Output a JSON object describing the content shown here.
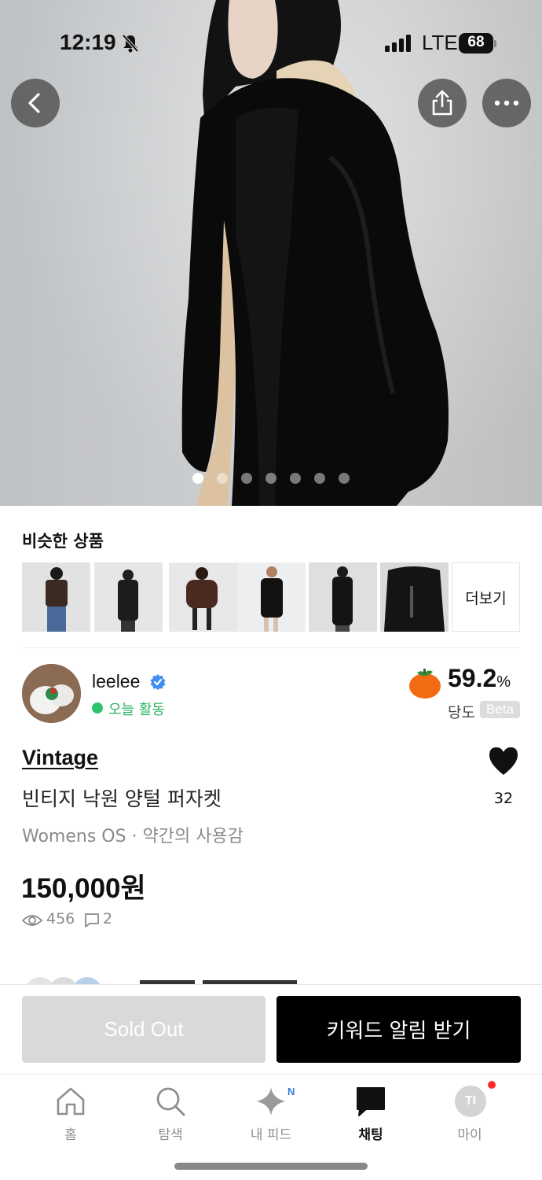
{
  "status_bar": {
    "time": "12:19",
    "network": "LTE",
    "battery": "68"
  },
  "hero": {
    "image_count": 7,
    "active_index": 0
  },
  "similar": {
    "title": "비슷한 상품",
    "more_label": "더보기",
    "thumb_count": 6
  },
  "seller": {
    "name": "leelee",
    "activity": "오늘 활동",
    "score_value": "59.2",
    "score_unit": "%",
    "score_label": "당도",
    "beta_label": "Beta"
  },
  "product": {
    "brand": "Vintage",
    "name": "빈티지 낙원 양털 퍼자켓",
    "meta": "Womens OS · 약간의 사용감",
    "price": "150,000원",
    "likes": "32",
    "views": "456",
    "chats": "2"
  },
  "actions": {
    "sold_out_label": "Sold Out",
    "keyword_alert_label": "키워드 알림 받기"
  },
  "tabbar": {
    "items": [
      {
        "label": "홈",
        "icon": "home-icon"
      },
      {
        "label": "탐색",
        "icon": "search-icon"
      },
      {
        "label": "내 피드",
        "icon": "sparkle-icon",
        "badge": "N"
      },
      {
        "label": "채팅",
        "icon": "chat-icon",
        "active": true
      },
      {
        "label": "마이",
        "icon": "profile-icon",
        "avatar_text": "TI"
      }
    ]
  },
  "colors": {
    "online_green": "#2bc46a",
    "sold_out_gray": "#d9d9d9",
    "primary_black": "#000000",
    "notification_red": "#ff2a2a"
  }
}
